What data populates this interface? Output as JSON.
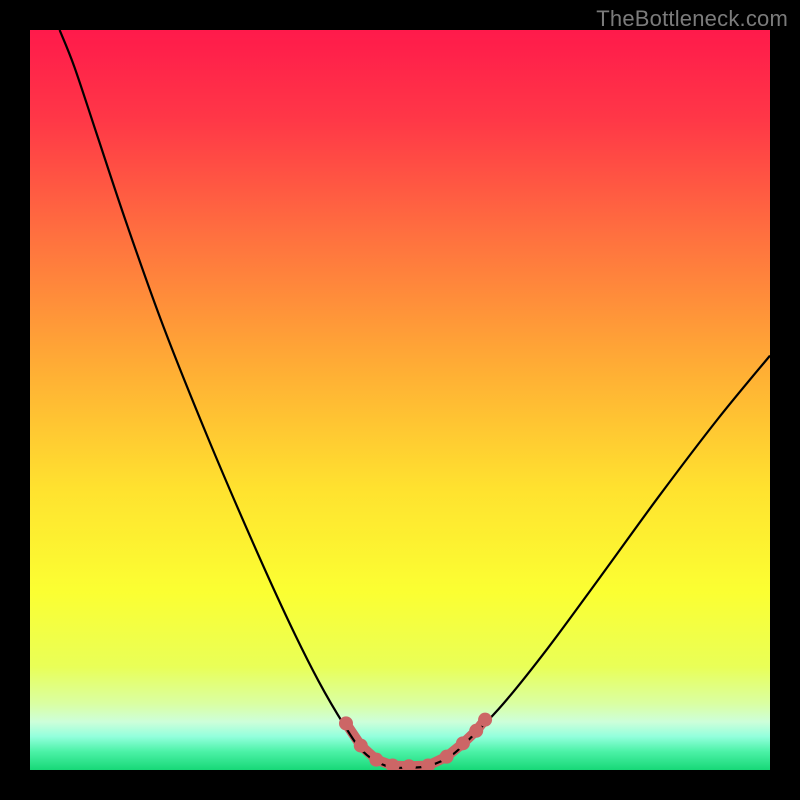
{
  "watermark": "TheBottleneck.com",
  "chart_data": {
    "type": "line",
    "title": "",
    "xlabel": "",
    "ylabel": "",
    "xlim": [
      0,
      100
    ],
    "ylim": [
      0,
      100
    ],
    "grid": false,
    "legend": null,
    "background_gradient_stops": [
      {
        "offset": 0.0,
        "color": "#ff1a4b"
      },
      {
        "offset": 0.12,
        "color": "#ff3747"
      },
      {
        "offset": 0.28,
        "color": "#ff713f"
      },
      {
        "offset": 0.45,
        "color": "#ffab35"
      },
      {
        "offset": 0.62,
        "color": "#ffe22f"
      },
      {
        "offset": 0.76,
        "color": "#fbff32"
      },
      {
        "offset": 0.86,
        "color": "#e9ff57"
      },
      {
        "offset": 0.91,
        "color": "#daffa2"
      },
      {
        "offset": 0.935,
        "color": "#cdffda"
      },
      {
        "offset": 0.955,
        "color": "#92ffdc"
      },
      {
        "offset": 0.975,
        "color": "#4cf2a7"
      },
      {
        "offset": 1.0,
        "color": "#17d877"
      }
    ],
    "series": [
      {
        "name": "bottleneck-curve",
        "color": "#000000",
        "width": 2.2,
        "points": [
          {
            "x": 4.0,
            "y": 100.0
          },
          {
            "x": 6.0,
            "y": 95.0
          },
          {
            "x": 9.0,
            "y": 86.0
          },
          {
            "x": 13.0,
            "y": 74.0
          },
          {
            "x": 18.0,
            "y": 60.0
          },
          {
            "x": 24.0,
            "y": 45.0
          },
          {
            "x": 30.0,
            "y": 31.0
          },
          {
            "x": 35.0,
            "y": 20.0
          },
          {
            "x": 39.0,
            "y": 12.0
          },
          {
            "x": 42.5,
            "y": 6.0
          },
          {
            "x": 45.0,
            "y": 2.5
          },
          {
            "x": 48.0,
            "y": 0.6
          },
          {
            "x": 51.0,
            "y": 0.3
          },
          {
            "x": 54.0,
            "y": 0.6
          },
          {
            "x": 57.0,
            "y": 2.0
          },
          {
            "x": 60.0,
            "y": 4.8
          },
          {
            "x": 64.0,
            "y": 9.0
          },
          {
            "x": 70.0,
            "y": 16.5
          },
          {
            "x": 77.0,
            "y": 26.0
          },
          {
            "x": 85.0,
            "y": 37.0
          },
          {
            "x": 93.0,
            "y": 47.5
          },
          {
            "x": 100.0,
            "y": 56.0
          }
        ]
      },
      {
        "name": "flat-bottom-markers",
        "color": "#cc6666",
        "marker_radius": 7,
        "line_width": 10,
        "points": [
          {
            "x": 42.7,
            "y": 6.3
          },
          {
            "x": 44.7,
            "y": 3.3
          },
          {
            "x": 46.8,
            "y": 1.4
          },
          {
            "x": 49.0,
            "y": 0.6
          },
          {
            "x": 51.2,
            "y": 0.5
          },
          {
            "x": 53.8,
            "y": 0.6
          },
          {
            "x": 56.3,
            "y": 1.8
          },
          {
            "x": 58.5,
            "y": 3.6
          },
          {
            "x": 60.3,
            "y": 5.3
          },
          {
            "x": 61.5,
            "y": 6.8
          }
        ]
      }
    ]
  }
}
